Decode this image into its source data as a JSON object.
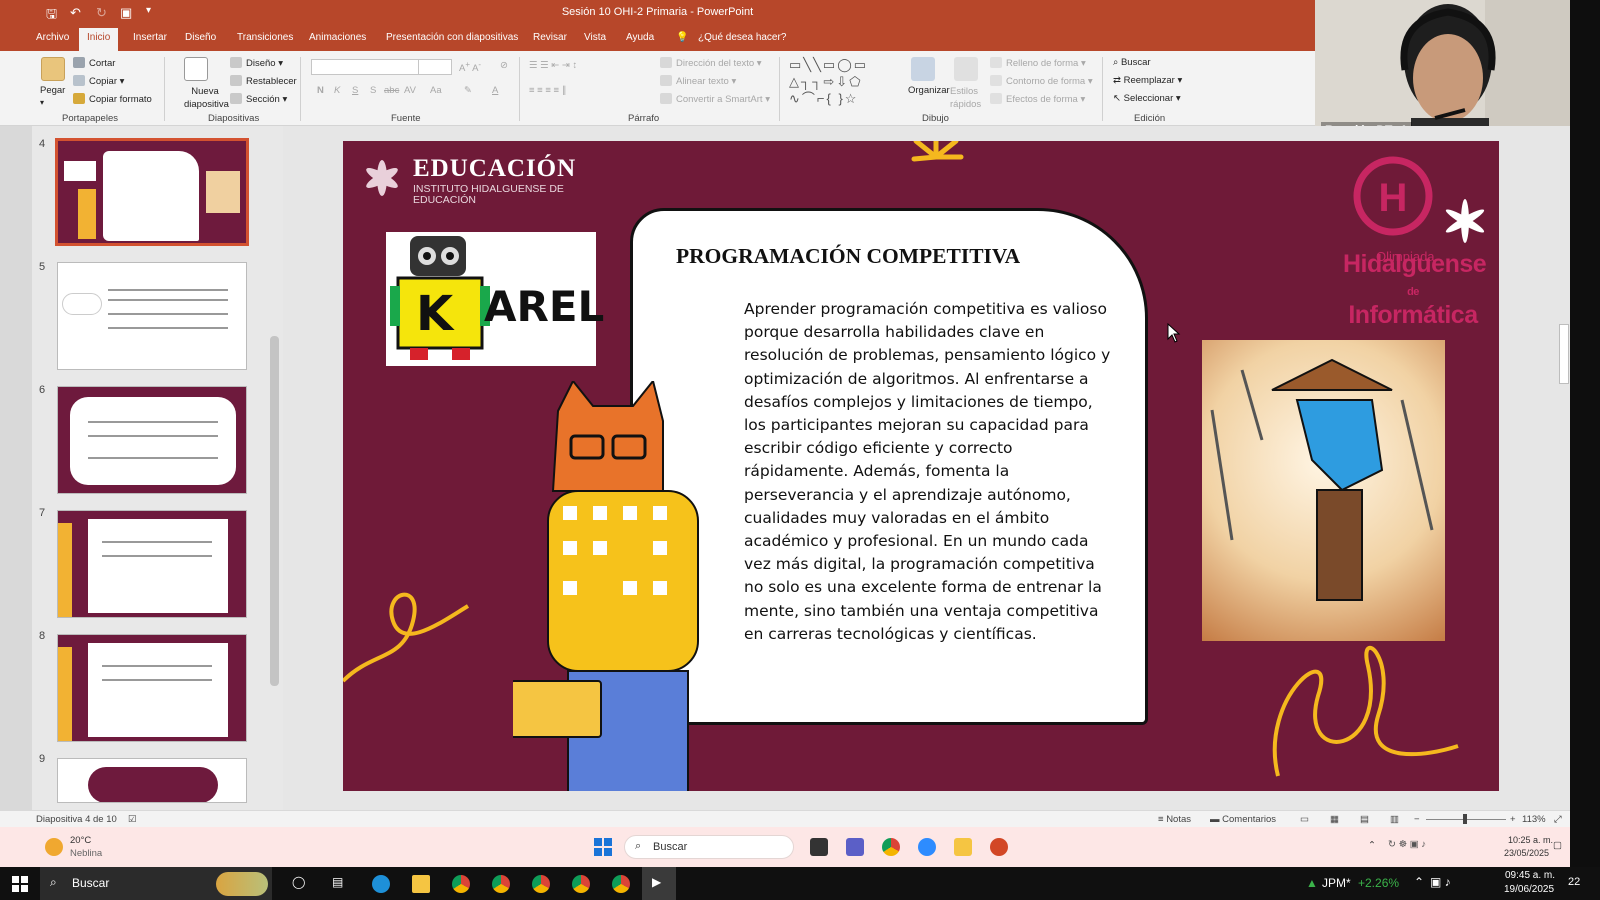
{
  "app": {
    "window_title": "Sesión 10 OHI-2 Primaria  -  PowerPoint"
  },
  "menu_tabs": [
    "Archivo",
    "Inicio",
    "Insertar",
    "Diseño",
    "Transiciones",
    "Animaciones",
    "Presentación con diapositivas",
    "Revisar",
    "Vista",
    "Ayuda"
  ],
  "tell_me": "¿Qué desea hacer?",
  "ribbon": {
    "portapapeles": {
      "paste": "Pegar",
      "cut": "Cortar",
      "copy": "Copiar",
      "format_painter": "Copiar formato",
      "group": "Portapapeles"
    },
    "diapositivas": {
      "new_slide": "Nueva diapositiva",
      "layout": "Diseño",
      "reset": "Restablecer",
      "section": "Sección",
      "group": "Diapositivas"
    },
    "fuente": {
      "group": "Fuente",
      "bold": "N",
      "italic": "K",
      "underline": "S",
      "shadow": "S",
      "strike": "abc",
      "spacing": "AV",
      "case": "Aa"
    },
    "parrafo": {
      "text_direction": "Dirección del texto",
      "align_text": "Alinear texto",
      "smartart": "Convertir a SmartArt",
      "group": "Párrafo"
    },
    "dibujo": {
      "arrange": "Organizar",
      "quick_styles": "Estilos rápidos",
      "shape_fill": "Relleno de forma",
      "shape_outline": "Contorno de forma",
      "shape_effects": "Efectos de forma",
      "group": "Dibujo"
    },
    "edicion": {
      "find": "Buscar",
      "replace": "Reemplazar",
      "select": "Seleccionar",
      "group": "Edición"
    }
  },
  "webcam": {
    "label": "Reunión DTpA"
  },
  "thumbnails": [
    "4",
    "5",
    "6",
    "7",
    "8",
    "9"
  ],
  "slide": {
    "edu_title": "EDUCACIÓN",
    "edu_subtitle": "INSTITUTO HIDALGUENSE DE EDUCACIÓN",
    "karel_logo": "AREL",
    "karel_k": "K",
    "card_title": "PROGRAMACIÓN COMPETITIVA",
    "card_body": "Aprender programación competitiva es valioso porque desarrolla habilidades clave en resolución de problemas, pensamiento lógico y optimización de algoritmos. Al enfrentarse a desafíos complejos y limitaciones de tiempo, los participantes mejoran su capacidad para escribir código eficiente y correcto rápidamente. Además, fomenta la perseverancia y el aprendizaje autónomo, cualidades muy valoradas en el ámbito académico y profesional. En un mundo cada vez más digital, la programación competitiva no solo es una excelente forma de entrenar la mente, sino también una ventaja competitiva en carreras tecnológicas y científicas.",
    "olimp_small": "Olimpiada",
    "olimp_line1": "Hidalguense",
    "olimp_de": "de",
    "olimp_line2": "Informática",
    "colors": {
      "background": "#6f1a38",
      "accent_pink": "#c72662",
      "yellow": "#f5b81e"
    }
  },
  "status": {
    "slide_counter": "Diapositiva 4 de 10",
    "notes": "Notas",
    "comments": "Comentarios",
    "zoom": "113%"
  },
  "inner_taskbar": {
    "temp": "20°C",
    "weather": "Neblina",
    "search": "Buscar",
    "time": "10:25 a. m.",
    "date": "23/05/2025"
  },
  "outer_taskbar": {
    "search": "Buscar",
    "stock": "JPM*",
    "stock_change": "+2.26%",
    "time": "09:45 a. m.",
    "date": "19/06/2025",
    "notifications": "22"
  }
}
